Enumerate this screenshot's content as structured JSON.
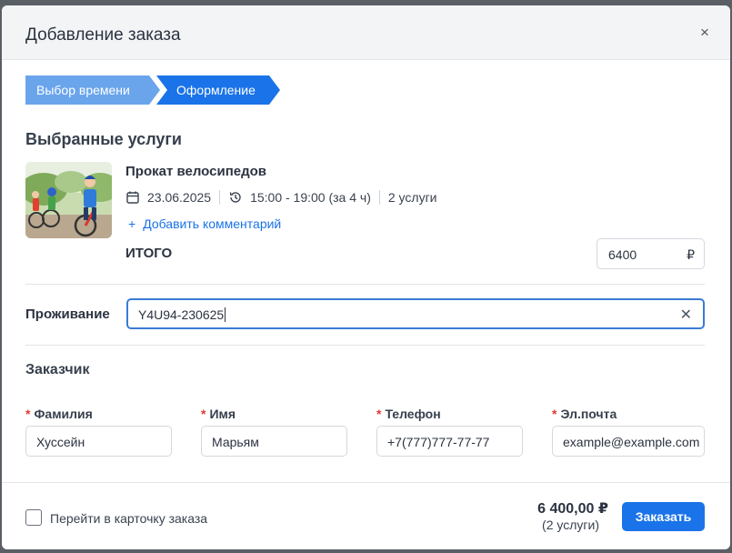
{
  "dialog": {
    "title": "Добавление заказа",
    "close_icon": "×"
  },
  "steps": [
    {
      "label": "Выбор времени",
      "state": "completed"
    },
    {
      "label": "Оформление",
      "state": "active"
    }
  ],
  "services": {
    "title": "Выбранные услуги",
    "item": {
      "name": "Прокат велосипедов",
      "date": "23.06.2025",
      "time": "15:00 - 19:00 (за 4 ч)",
      "count": "2 услуги",
      "add_comment": "Добавить комментарий",
      "add_comment_icon": "+"
    },
    "total_label": "ИТОГО",
    "total_value": "6400",
    "total_currency": "₽"
  },
  "stay": {
    "label": "Проживание",
    "value": "Y4U94-230625",
    "clear_icon": "✕"
  },
  "customer": {
    "title": "Заказчик",
    "required_mark": "*",
    "fields": [
      {
        "label": "Фамилия",
        "value": "Хуссейн"
      },
      {
        "label": "Имя",
        "value": "Марьям"
      },
      {
        "label": "Телефон",
        "value": "+7(777)777-77-77"
      },
      {
        "label": "Эл.почта",
        "value": "example@example.com"
      }
    ]
  },
  "footer": {
    "checkbox_label": "Перейти в карточку заказа",
    "checkbox_checked": false,
    "total": "6 400,00 ₽",
    "services_count": "(2 услуги)",
    "order_button": "Заказать"
  },
  "colors": {
    "accent": "#1a73e8",
    "step_completed": "#6aa5ec",
    "required": "#e53935"
  }
}
